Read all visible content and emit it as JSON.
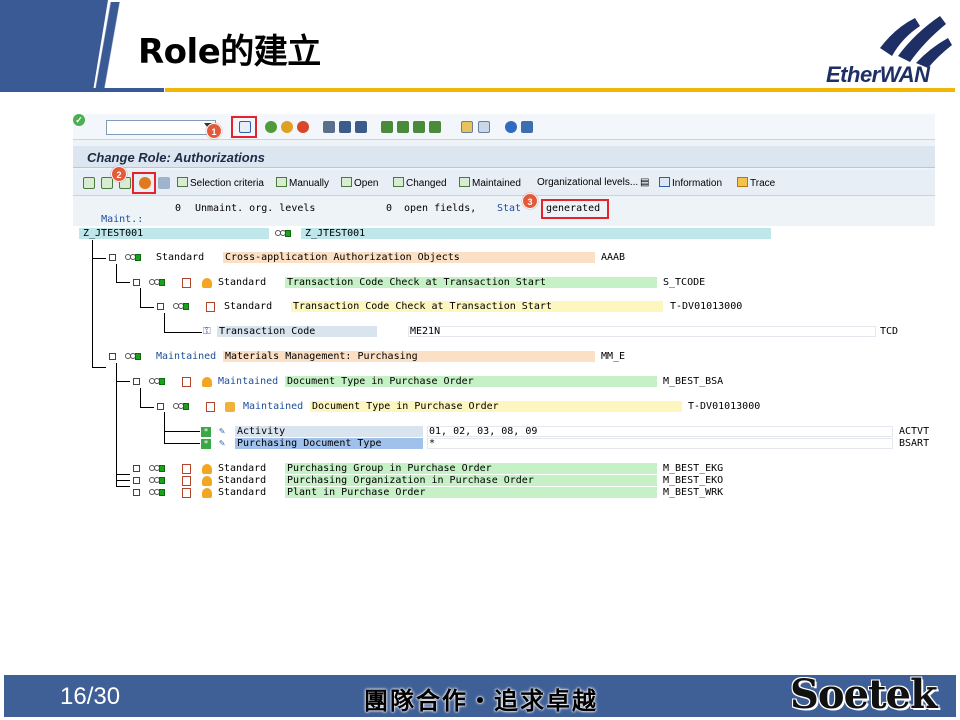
{
  "slide": {
    "title": "Role的建立",
    "page": "16/30",
    "slogan": "團隊合作・追求卓越",
    "brand": "Soetek",
    "logo_text": "EtherWAN"
  },
  "sap": {
    "screen_title": "Change Role: Authorizations",
    "app_toolbar": [
      "Selection criteria",
      "Manually",
      "Open",
      "Changed",
      "Maintained",
      "Organizational levels...",
      "Information",
      "Trace"
    ],
    "status_line": {
      "maint_label": "Maint.:",
      "unmaint_count": "0",
      "unmaint_label": "Unmaint. org. levels",
      "open_count": "0",
      "open_label": "open fields,",
      "status_label": "Stat",
      "status_value": "generated"
    },
    "annotations": [
      "1",
      "2",
      "3"
    ],
    "tree": {
      "root": {
        "left": "Z_JTEST001",
        "right": "Z_JTEST001"
      },
      "std_class": {
        "kind": "Standard",
        "text": "Cross-application Authorization Objects",
        "code": "AAAB"
      },
      "std_obj": {
        "kind": "Standard",
        "text": "Transaction Code Check at Transaction Start",
        "code": "S_TCODE"
      },
      "std_auth": {
        "kind": "Standard",
        "text": "Transaction Code Check at Transaction Start",
        "code": "T-DV01013000"
      },
      "tcode_field": {
        "label": "Transaction Code",
        "value": "ME21N",
        "field": "TCD"
      },
      "mm_class": {
        "kind": "Maintained",
        "text": "Materials Management: Purchasing",
        "code": "MM_E"
      },
      "mm_obj": {
        "kind": "Maintained",
        "text": "Document Type in Purchase Order",
        "code": "M_BEST_BSA"
      },
      "mm_auth": {
        "kind": "Maintained",
        "text": "Document Type in Purchase Order",
        "code": "T-DV01013000"
      },
      "activity": {
        "label": "Activity",
        "value": "01, 02, 03, 08, 09",
        "field": "ACTVT"
      },
      "doctype": {
        "label": "Purchasing Document Type",
        "value": "*",
        "field": "BSART"
      },
      "bottom": [
        {
          "kind": "Standard",
          "text": "Purchasing Group in Purchase Order",
          "code": "M_BEST_EKG"
        },
        {
          "kind": "Standard",
          "text": "Purchasing Organization in Purchase Order",
          "code": "M_BEST_EKO"
        },
        {
          "kind": "Standard",
          "text": "Plant in Purchase Order",
          "code": "M_BEST_WRK"
        }
      ]
    }
  }
}
